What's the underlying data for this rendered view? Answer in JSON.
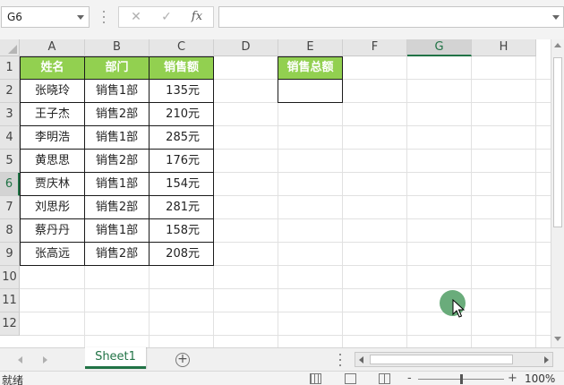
{
  "formula_bar": {
    "name_box": "G6",
    "cancel_icon": "✕",
    "enter_icon": "✓",
    "fx_label": "fx",
    "formula_value": ""
  },
  "grid": {
    "columns": [
      "A",
      "B",
      "C",
      "D",
      "E",
      "F",
      "G",
      "H"
    ],
    "rows": [
      "1",
      "2",
      "3",
      "4",
      "5",
      "6",
      "7",
      "8",
      "9",
      "10",
      "11",
      "12"
    ],
    "selected_cell": "G6"
  },
  "table": {
    "headers": [
      "姓名",
      "部门",
      "销售额"
    ],
    "rows": [
      [
        "张晓玲",
        "销售1部",
        "135元"
      ],
      [
        "王子杰",
        "销售2部",
        "210元"
      ],
      [
        "李明浩",
        "销售1部",
        "285元"
      ],
      [
        "黄思思",
        "销售2部",
        "176元"
      ],
      [
        "贾庆林",
        "销售1部",
        "154元"
      ],
      [
        "刘思彤",
        "销售2部",
        "281元"
      ],
      [
        "蔡丹丹",
        "销售1部",
        "158元"
      ],
      [
        "张高远",
        "销售2部",
        "208元"
      ]
    ]
  },
  "summary": {
    "header": "销售总额",
    "value": ""
  },
  "sheets": {
    "tabs": [
      "Sheet1"
    ],
    "active": "Sheet1",
    "add_icon": "+"
  },
  "status_bar": {
    "status_text": "就绪",
    "zoom_minus": "-",
    "zoom_plus": "+",
    "zoom_label": "100%",
    "zoom_level": 1.0
  },
  "colors": {
    "header_fill": "#92d050",
    "accent": "#217346",
    "click_indicator": "#5aa36d"
  },
  "icons": {
    "cancel": "close-icon",
    "enter": "check-icon",
    "fx": "function-icon",
    "add_sheet": "plus-circle-icon",
    "cursor": "mouse-cursor-icon"
  }
}
